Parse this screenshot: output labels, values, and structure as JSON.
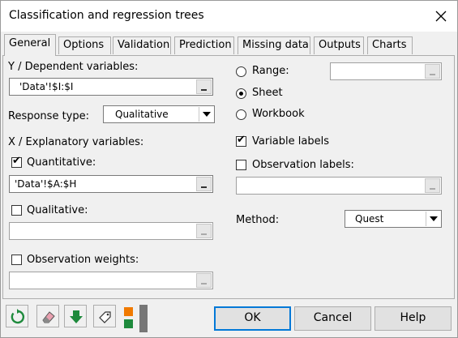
{
  "window": {
    "title": "Classification and regression trees"
  },
  "tabs": [
    "General",
    "Options",
    "Validation",
    "Prediction",
    "Missing data",
    "Outputs",
    "Charts"
  ],
  "general": {
    "y_label": "Y / Dependent variables:",
    "y_value": "'Data'!$I:$I",
    "response_type_label": "Response type:",
    "response_type_value": "Qualitative",
    "x_label": "X / Explanatory variables:",
    "quantitative_label": "Quantitative:",
    "quantitative_checked": true,
    "quantitative_value": "'Data'!$A:$H",
    "qualitative_label": "Qualitative:",
    "qualitative_checked": false,
    "qualitative_value": "",
    "weights_label": "Observation weights:",
    "weights_checked": false,
    "weights_value": "",
    "range_label": "Range:",
    "sheet_label": "Sheet",
    "workbook_label": "Workbook",
    "selected_output": "Sheet",
    "range_value": "",
    "variable_labels_label": "Variable labels",
    "variable_labels_checked": true,
    "observation_labels_label": "Observation labels:",
    "observation_labels_checked": false,
    "observation_labels_value": "",
    "method_label": "Method:",
    "method_value": "Quest"
  },
  "buttons": {
    "ok": "OK",
    "cancel": "Cancel",
    "help": "Help"
  },
  "icons": {
    "toolbar": [
      "refresh-icon",
      "eraser-icon",
      "down-arrow-icon",
      "tag-icon",
      "color-blocks-icon"
    ],
    "accent_green": "#1e8a3c",
    "accent_orange": "#f07a00",
    "focus_blue": "#0078d7"
  }
}
